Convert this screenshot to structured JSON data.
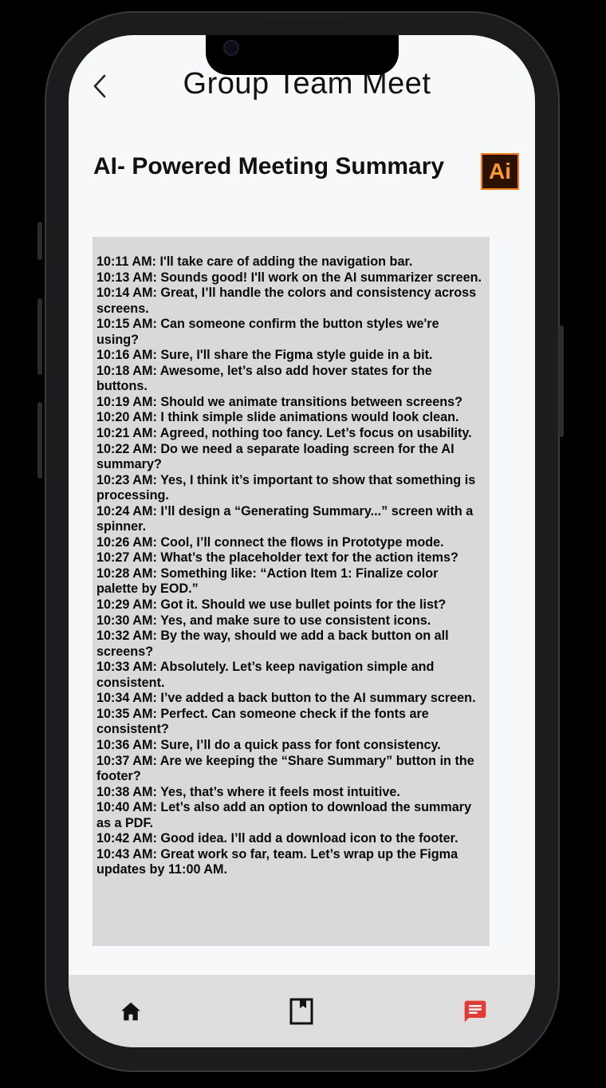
{
  "header": {
    "title": "Group Team Meet",
    "back_icon": "chevron-left-icon"
  },
  "summary": {
    "heading": "AI- Powered Meeting Summary",
    "logo_text": "Ai"
  },
  "transcript": [
    "10:11 AM: I'll take care of adding the navigation bar.",
    "10:13 AM: Sounds good! I'll work on the AI summarizer screen.",
    "10:14 AM: Great, I’ll handle the colors and consistency across screens.",
    "10:15 AM: Can someone confirm the button styles we're using?",
    "10:16 AM: Sure, I'll share the Figma style guide in a bit.",
    "10:18 AM: Awesome, let’s also add hover states for the buttons.",
    "10:19 AM: Should we animate transitions between screens?",
    "10:20 AM: I think simple slide animations would look clean.",
    "10:21 AM: Agreed, nothing too fancy. Let’s focus on usability.",
    "10:22 AM: Do we need a separate loading screen for the AI summary?",
    "10:23 AM: Yes, I think it’s important to show that something is processing.",
    "10:24 AM: I’ll design a “Generating Summary...” screen with a spinner.",
    "10:26 AM: Cool, I’ll connect the flows in Prototype mode.",
    "10:27 AM: What’s the placeholder text for the action items?",
    "10:28 AM: Something like: “Action Item 1: Finalize color palette by EOD.”",
    "10:29 AM: Got it. Should we use bullet points for the list?",
    "10:30 AM: Yes, and make sure to use consistent icons.",
    "10:32 AM: By the way, should we add a back button on all screens?",
    "10:33 AM: Absolutely. Let’s keep navigation simple and consistent.",
    "10:34 AM: I’ve added a back button to the AI summary screen.",
    "10:35 AM: Perfect. Can someone check if the fonts are consistent?",
    "10:36 AM: Sure, I’ll do a quick pass for font consistency.",
    "10:37 AM: Are we keeping the “Share Summary” button in the footer?",
    "10:38 AM: Yes, that’s where it feels most intuitive.",
    "10:40 AM: Let’s also add an option to download the summary as a PDF.",
    "10:42 AM: Good idea. I’ll add a download icon to the footer.",
    "10:43 AM: Great work so far, team. Let’s wrap up the Figma updates by 11:00 AM."
  ],
  "bottom_nav": {
    "items": [
      {
        "icon": "home-icon",
        "active": false
      },
      {
        "icon": "bookmark-icon",
        "active": false
      },
      {
        "icon": "chat-icon",
        "active": true
      }
    ],
    "active_color": "#e53935",
    "inactive_color": "#111111"
  },
  "colors": {
    "logo_border": "#ff7c00",
    "logo_bg": "#2b1200",
    "transcript_bg": "#d9d9d9"
  }
}
